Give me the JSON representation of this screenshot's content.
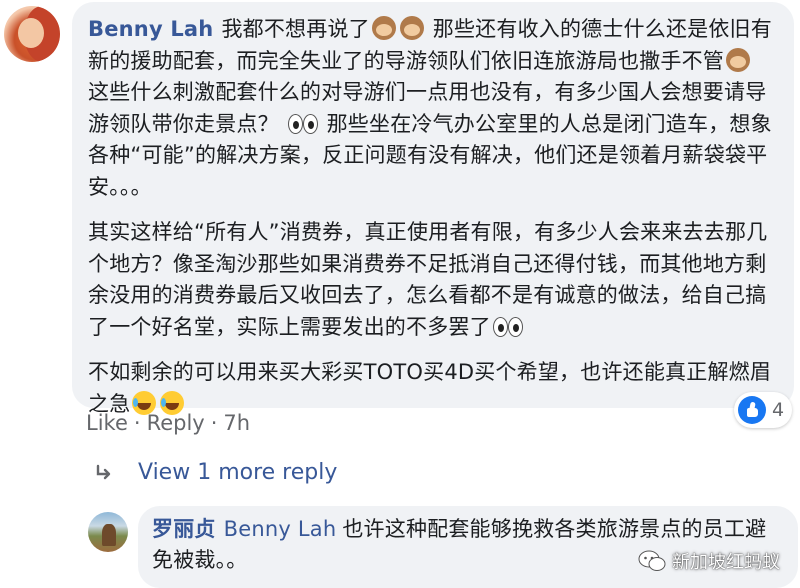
{
  "main_comment": {
    "author": "Benny Lah",
    "p1_a": "我都不想再说了",
    "p1_b": "那些还有收入的德士什么还是依旧有新的援助配套，而完全失业了的导游领队们依旧连旅游局也撒手不管",
    "p1_c": "这些什么刺激配套什么的对导游们一点用也没有，有多少国人会想要请导游领队带你走景点？",
    "p1_d": "那些坐在冷气办公室里的人总是闭门造车，想象各种“可能”的解决方案，反正问题有没有解决，他们还是领着月薪袋袋平安。。。",
    "p2": "其实这样给“所有人”消费券，真正使用者有限，有多少人会来来去去那几个地方？像圣淘沙那些如果消费券不足抵消自己还得付钱，而其他地方剩余没用的消费券最后又收回去了，怎么看都不是有诚意的做法，给自己搞了一个好名堂，实际上需要发出的不多罢了",
    "p3": "不如剩余的可以用来买大彩买TOTO买4D买个希望，也许还能真正解燃眉之急",
    "reaction_count": "4"
  },
  "actions": {
    "like": "Like",
    "dot1": "·",
    "reply": "Reply",
    "dot2": "·",
    "time": "7h"
  },
  "view_more": "View 1 more reply",
  "reply_comment": {
    "author": "罗丽贞",
    "mention": "Benny Lah",
    "text": "也许这种配套能够挽救各类旅游景点的员工避免被裁。。"
  },
  "watermark": "新加坡红蚂蚁",
  "colors": {
    "name_blue": "#385898",
    "bubble_bg": "#f0f2f5",
    "meta_gray": "#65676b",
    "like_blue": "#1877f2"
  },
  "icons": {
    "monkey": "see-no-evil-monkey-icon",
    "eyes": "eyes-icon",
    "laugh": "tears-of-joy-icon",
    "like": "like-icon",
    "reply_arrow": "reply-arrow-icon",
    "wechat": "wechat-icon"
  }
}
